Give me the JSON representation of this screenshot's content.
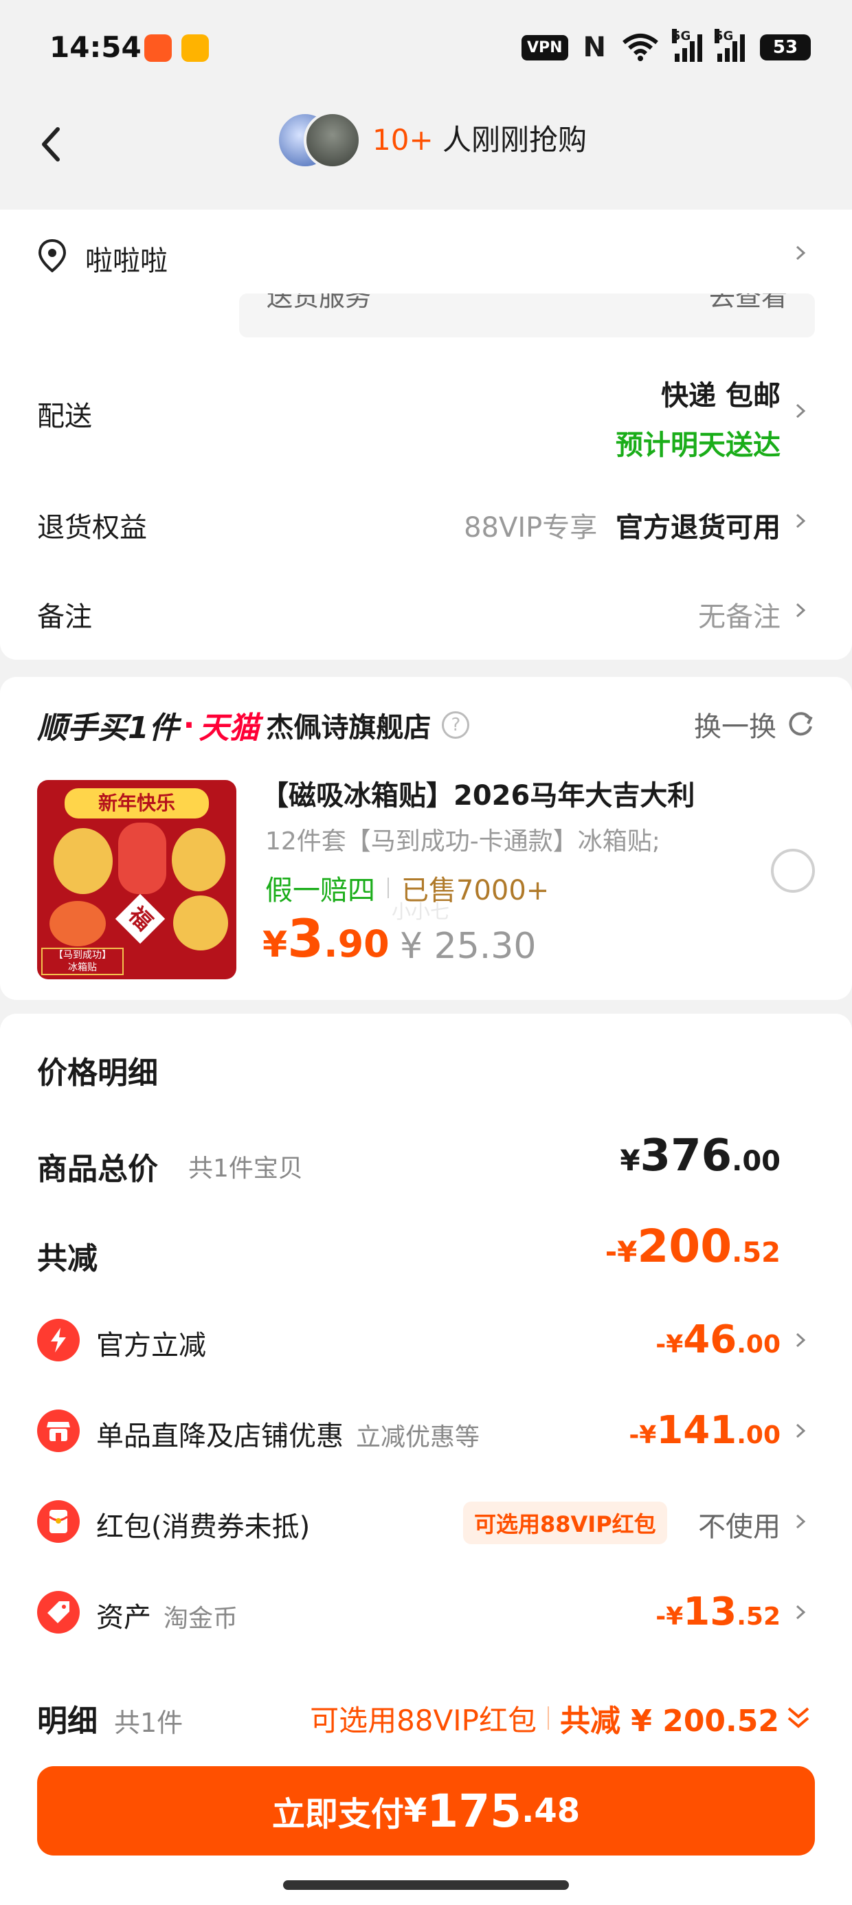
{
  "status_bar": {
    "time": "14:54",
    "vpn": "VPN",
    "nfc": "N",
    "battery": "53",
    "network": [
      "5G",
      "5G"
    ]
  },
  "header": {
    "count": "10+",
    "text": "人刚刚抢购"
  },
  "address": {
    "name": "啦啦啦",
    "hidden_left": "送货服务",
    "hidden_right": "去查看"
  },
  "delivery": {
    "label": "配送",
    "method": "快递 包邮",
    "eta": "预计明天送达"
  },
  "returns": {
    "label": "退货权益",
    "vip": "88VIP专享",
    "value": "官方退货可用"
  },
  "note": {
    "label": "备注",
    "value": "无备注"
  },
  "addon": {
    "title_prefix": "顺手买",
    "title_count": "1件",
    "dot": "·",
    "mall": "天猫",
    "store": "杰佩诗旗舰店",
    "swap": "换一换",
    "product": {
      "name": "【磁吸冰箱贴】2026马年大吉大利",
      "spec": "12件套【马到成功-卡通款】冰箱贴;",
      "guarantee": "假一赔四",
      "sold": "已售7000+",
      "price_symbol": "¥",
      "price_int": "3",
      "price_dec": ".90",
      "original": "¥ 25.30",
      "watermark": "小小七",
      "image_texts": [
        "新年快乐",
        "福",
        "【马到成功】",
        "冰箱贴"
      ]
    }
  },
  "price_detail": {
    "title": "价格明细",
    "total": {
      "label": "商品总价",
      "sub": "共1件宝贝",
      "symbol": "¥",
      "int": "376",
      "dec": ".00"
    },
    "discount": {
      "label": "共减",
      "prefix": "-¥",
      "int": "200",
      "dec": ".52"
    },
    "rows": [
      {
        "label": "官方立减",
        "sub": "",
        "prefix": "-¥",
        "int": "46",
        "dec": ".00",
        "icon": "lightning-icon"
      },
      {
        "label": "单品直降及店铺优惠",
        "sub": "立减优惠等",
        "prefix": "-¥",
        "int": "141",
        "dec": ".00",
        "icon": "shop-icon"
      },
      {
        "label": "红包(消费券未抵)",
        "sub": "",
        "badge": "可选用88VIP红包",
        "value": "不使用",
        "icon": "red-packet-icon"
      },
      {
        "label": "资产",
        "sub": "淘金币",
        "prefix": "-¥",
        "int": "13",
        "dec": ".52",
        "icon": "coin-tag-icon"
      }
    ]
  },
  "footer": {
    "label": "明细",
    "sub": "共1件",
    "hint": "可选用88VIP红包",
    "saved": "共减 ¥ 200.52",
    "pay_label": "立即支付",
    "pay_symbol": "¥",
    "pay_int": "175",
    "pay_dec": ".48"
  },
  "colors": {
    "accent": "#ff5000",
    "green": "#1aad19",
    "bg": "#f2f2f2",
    "red_icon": "#ff3b30"
  }
}
